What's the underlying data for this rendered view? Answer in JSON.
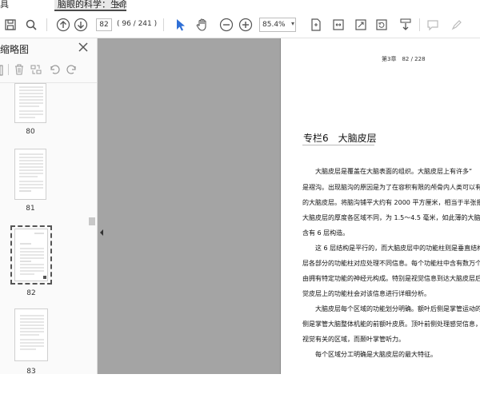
{
  "tabs": {
    "left_label": "具",
    "active_label": "脑眼的科学：生命...",
    "close_glyph": "×"
  },
  "toolbar": {
    "page_current": "82",
    "page_count": "( 96 / 241 )",
    "zoom": "85.4%",
    "zoom_caret": "▾",
    "icons": [
      "save-icon",
      "search-icon",
      "prev-page-icon",
      "next-page-icon",
      "select-cursor-icon",
      "hand-icon",
      "zoom-out-icon",
      "zoom-in-icon",
      "fit-page-icon",
      "fit-width-icon",
      "full-screen-icon",
      "rotate-icon",
      "download-icon",
      "comment-icon",
      "highlighter-icon"
    ]
  },
  "sidebar": {
    "title": "缩略图",
    "tools": [
      "page-settings-icon",
      "delete-icon",
      "split-icon",
      "rotate-left-icon",
      "rotate-right-icon"
    ],
    "thumbnails": [
      {
        "label": "80",
        "selected": false
      },
      {
        "label": "81",
        "selected": false
      },
      {
        "label": "82",
        "selected": true
      },
      {
        "label": "83",
        "selected": false
      }
    ]
  },
  "document": {
    "running_header": "第3章　82 / 228",
    "section_heading": "专栏6　大脑皮层",
    "lines": [
      "大脑皮层是覆盖在大脑表面的组织。大脑皮层上有许多“",
      "是褶沟。出现脑沟的原因是为了在容积有限的颅骨内人类可以有",
      "的大脑皮层。将脑沟铺平大约有 2000 平方厘米，相当于半张报",
      "大脑皮层的厚度各区域不同，为 1.5～4.5 毫米，如此薄的大脑皮",
      "含有 6 层构造。",
      "这 6 层结构是平行的，而大脑皮层中的功能柱则是垂直结构",
      "层各部分的功能柱对应处理不同信息。每个功能柱中含有数万个",
      "由拥有特定功能的神经元构成。特别是视觉信息到达大脑皮层后",
      "觉皮层上的功能柱会对该信息进行详细分析。",
      "大脑皮层每个区域的功能划分明确。额叶后侧是掌管运动的",
      "侧是掌管大脑整体机能的前额叶皮质。顶叶前侧处理感觉信息，",
      "视觉有关的区域，而颞叶掌管听力。",
      "每个区域分工明确是大脑皮层的最大特征。"
    ]
  }
}
